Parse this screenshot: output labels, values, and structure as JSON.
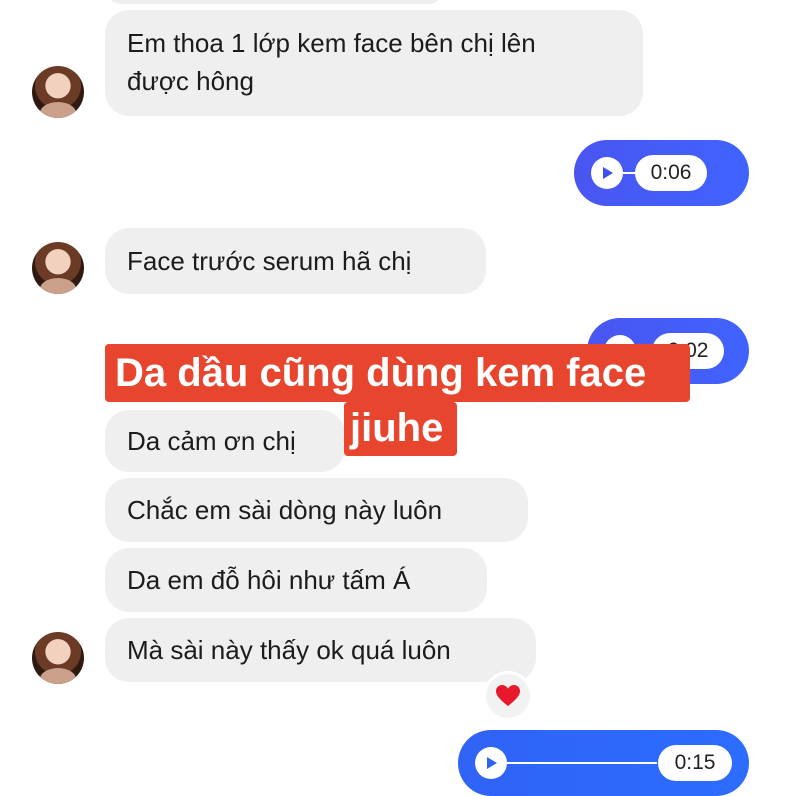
{
  "messages": {
    "m1": "Em thoa 1 lớp kem face bên chị lên",
    "m1b": "được hông",
    "m2": "Face trước serum hã chị",
    "m3": "Da cảm ơn chị",
    "m4": "Chắc em sài dòng này luôn",
    "m5": "Da em đỗ hôi như tấm Á",
    "m6": "Mà sài này thấy ok quá luôn"
  },
  "voice": {
    "v1_time": "0:06",
    "v2_time": "0:02",
    "v3_time": "0:15"
  },
  "overlay": {
    "line1": "Da dầu cũng dùng kem face",
    "line2": "jiuhe"
  },
  "reaction": {
    "icon": "heart-icon",
    "color": "#e8192c"
  },
  "colors": {
    "voice_bubble": "#4a55f0",
    "banner": "#e8452f",
    "incoming_bubble": "#efefef"
  }
}
